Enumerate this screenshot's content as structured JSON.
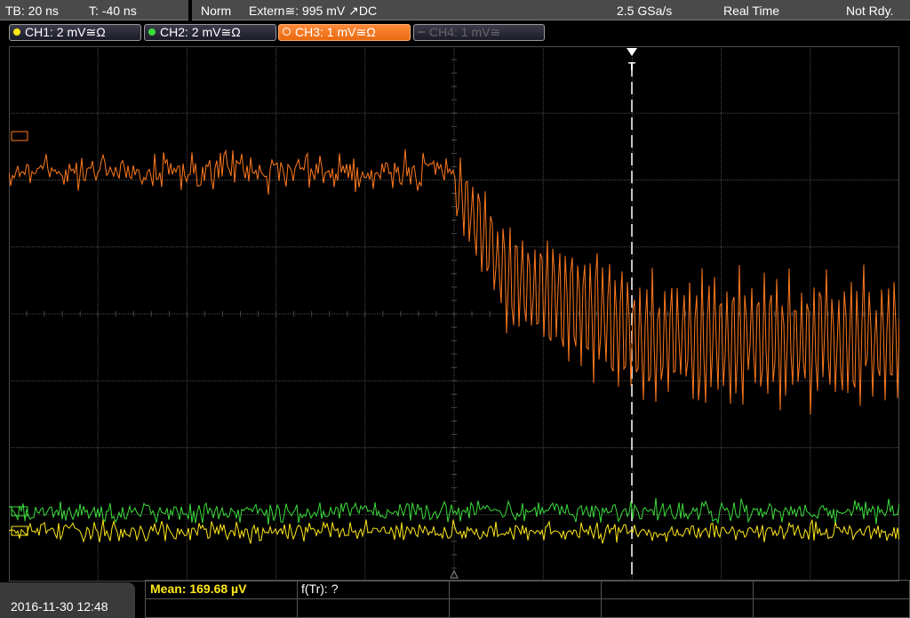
{
  "topbar": {
    "timebase": "TB: 20 ns",
    "trigger_time": "T: -40 ns",
    "mode": "Norm",
    "trigger_source": "Extern≅: 995 mV ↗DC",
    "sample_rate": "2.5 GSa/s",
    "acquisition": "Real Time",
    "status": "Not Rdy."
  },
  "channels": [
    {
      "label": "CH1: 2 mV≅Ω",
      "color": "#ffe81a",
      "state": "on"
    },
    {
      "label": "CH2: 2 mV≅Ω",
      "color": "#3cdc3c",
      "state": "on"
    },
    {
      "label": "CH3: 1 mV≅Ω",
      "color": "#ff7a1e",
      "state": "selected"
    },
    {
      "label": "CH4: 1 mV≅",
      "color": "#666666",
      "state": "off"
    }
  ],
  "trigger_marker": "T",
  "measurement": {
    "mean": "Mean: 169.68 µV",
    "ftr": "f(Tr): ?"
  },
  "datetime": "2016-11-30 12:48",
  "colors": {
    "grid": "#505050",
    "ch1": "#ffe81a",
    "ch2": "#3cdc3c",
    "ch3": "#ff7a1e",
    "panel": "#4a4a4a"
  }
}
